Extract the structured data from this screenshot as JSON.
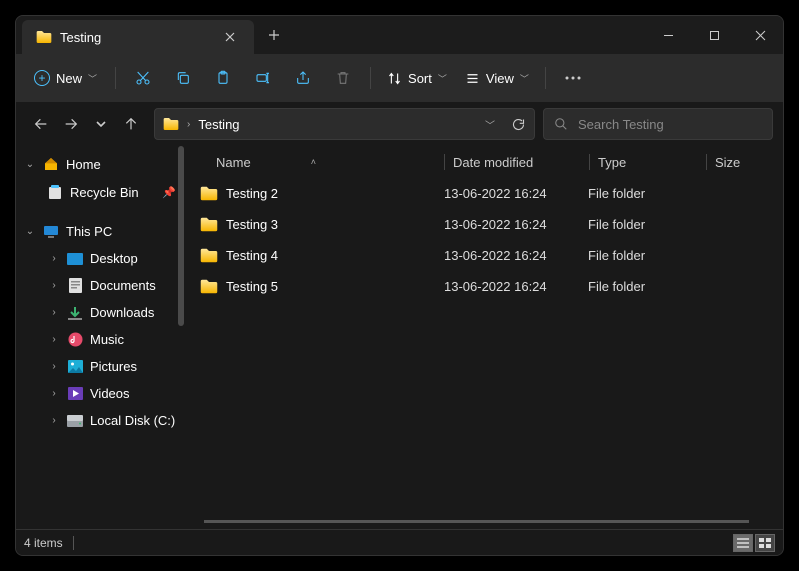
{
  "tab": {
    "title": "Testing"
  },
  "toolbar": {
    "new_label": "New",
    "sort_label": "Sort",
    "view_label": "View"
  },
  "address": {
    "path": "Testing"
  },
  "search": {
    "placeholder": "Search Testing"
  },
  "columns": {
    "name": "Name",
    "date": "Date modified",
    "type": "Type",
    "size": "Size"
  },
  "sidebar": {
    "home": "Home",
    "recycle": "Recycle Bin",
    "thispc": "This PC",
    "desktop": "Desktop",
    "documents": "Documents",
    "downloads": "Downloads",
    "music": "Music",
    "pictures": "Pictures",
    "videos": "Videos",
    "localc": "Local Disk (C:)"
  },
  "rows": [
    {
      "name": "Testing 2",
      "date": "13-06-2022 16:24",
      "type": "File folder"
    },
    {
      "name": "Testing 3",
      "date": "13-06-2022 16:24",
      "type": "File folder"
    },
    {
      "name": "Testing 4",
      "date": "13-06-2022 16:24",
      "type": "File folder"
    },
    {
      "name": "Testing 5",
      "date": "13-06-2022 16:24",
      "type": "File folder"
    }
  ],
  "status": {
    "count": "4 items"
  }
}
